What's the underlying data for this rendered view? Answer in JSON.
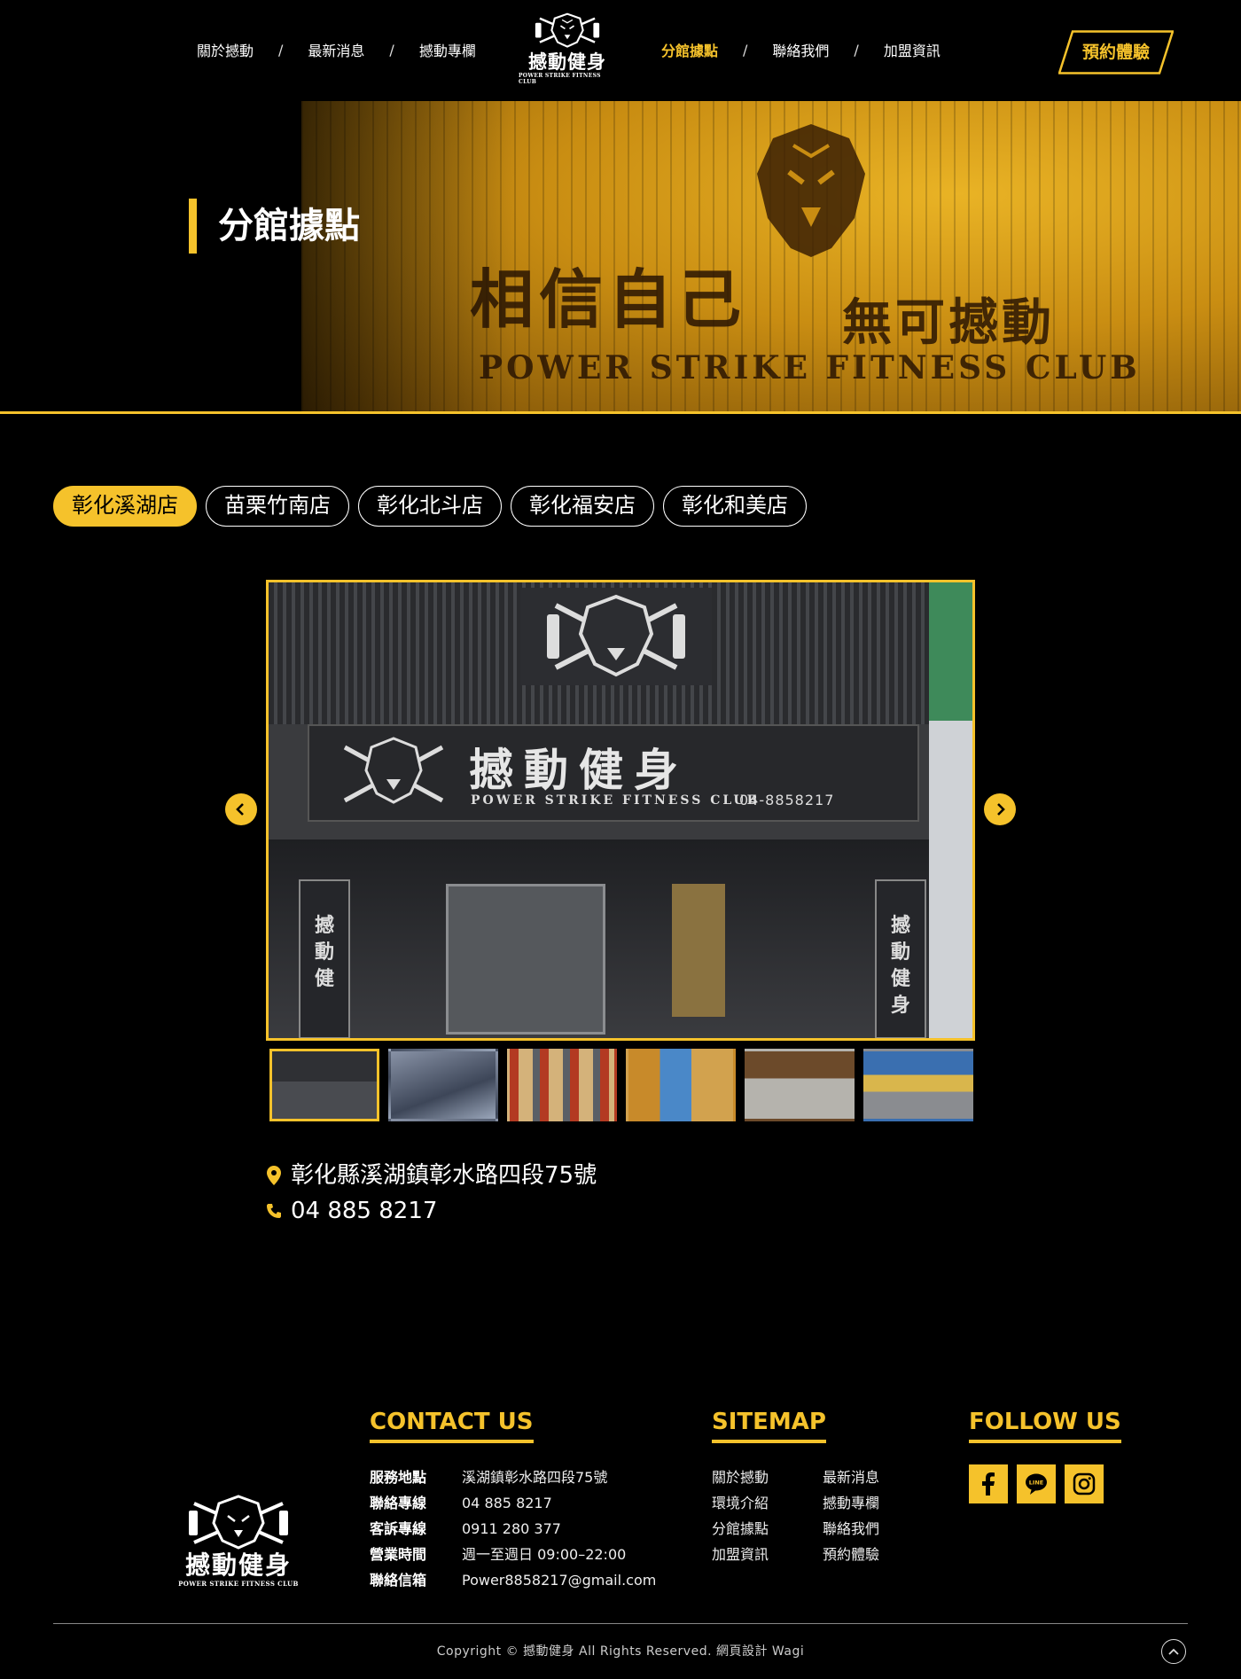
{
  "header": {
    "nav_left": [
      "關於撼動",
      "最新消息",
      "撼動專欄"
    ],
    "nav_right": [
      "分館據點",
      "聯絡我們",
      "加盟資訊"
    ],
    "separator": "/",
    "logo_text": "撼動健身",
    "logo_sub": "POWER STRIKE FITNESS CLUB",
    "book_button": "預約體驗",
    "active_nav": "分館據點"
  },
  "hero": {
    "title": "分館據點",
    "wall_text": "相信自己",
    "wall_text2": "無可撼動",
    "wall_eng": "POWER STRIKE FITNESS CLUB"
  },
  "tabs": [
    "彰化溪湖店",
    "苗栗竹南店",
    "彰化北斗店",
    "彰化福安店",
    "彰化和美店"
  ],
  "gallery": {
    "sign_text": "撼動健身",
    "sign_eng": "POWER STRIKE FITNESS CLUB",
    "sign_phone": "04-8858217",
    "banner_text": "撼\n動\n健",
    "banner_text_r": "撼\n動\n健\n身",
    "thumbnail_count": 6,
    "active_thumb": 1
  },
  "store": {
    "address": "彰化縣溪湖鎮彰水路四段75號",
    "phone": "04 885 8217"
  },
  "footer": {
    "logo_text": "撼動健身",
    "logo_sub": "POWER STRIKE FITNESS CLUB",
    "contact_heading": "CONTACT US",
    "contact": [
      {
        "k": "服務地點",
        "v": "溪湖鎮彰水路四段75號"
      },
      {
        "k": "聯絡專線",
        "v": "04 885 8217"
      },
      {
        "k": "客訴專線",
        "v": "0911 280 377"
      },
      {
        "k": "營業時間",
        "v": "週一至週日 09:00–22:00"
      },
      {
        "k": "聯絡信箱",
        "v": "Power8858217@gmail.com"
      }
    ],
    "sitemap_heading": "SITEMAP",
    "sitemap": [
      "關於撼動",
      "最新消息",
      "環境介紹",
      "撼動專欄",
      "分館據點",
      "聯絡我們",
      "加盟資訊",
      "預約體驗"
    ],
    "follow_heading": "FOLLOW US",
    "social": [
      "facebook-icon",
      "line-icon",
      "instagram-icon"
    ],
    "copyright": "Copyright © 撼動健身 All Rights Reserved. 網頁設計 Wagi"
  },
  "colors": {
    "accent": "#f5c22b",
    "background": "#000000"
  }
}
